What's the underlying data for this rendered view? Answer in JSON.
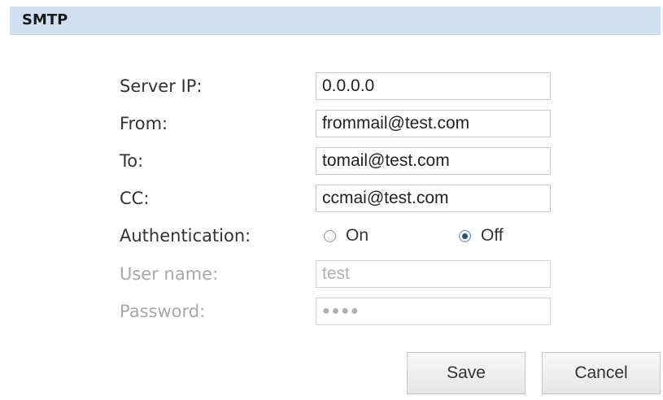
{
  "panel": {
    "title": "SMTP"
  },
  "form": {
    "server_ip": {
      "label": "Server IP:",
      "value": "0.0.0.0"
    },
    "from": {
      "label": "From:",
      "value": "frommail@test.com"
    },
    "to": {
      "label": "To:",
      "value": "tomail@test.com"
    },
    "cc": {
      "label": "CC:",
      "value": "ccmai@test.com"
    },
    "authentication": {
      "label": "Authentication:",
      "options": [
        {
          "label": "On",
          "checked": false
        },
        {
          "label": "Off",
          "checked": true
        }
      ]
    },
    "username": {
      "label": "User name:",
      "value": "test",
      "disabled": true
    },
    "password": {
      "label": "Password:",
      "value": "●●●●",
      "disabled": true
    }
  },
  "buttons": {
    "save_label": "Save",
    "cancel_label": "Cancel"
  }
}
